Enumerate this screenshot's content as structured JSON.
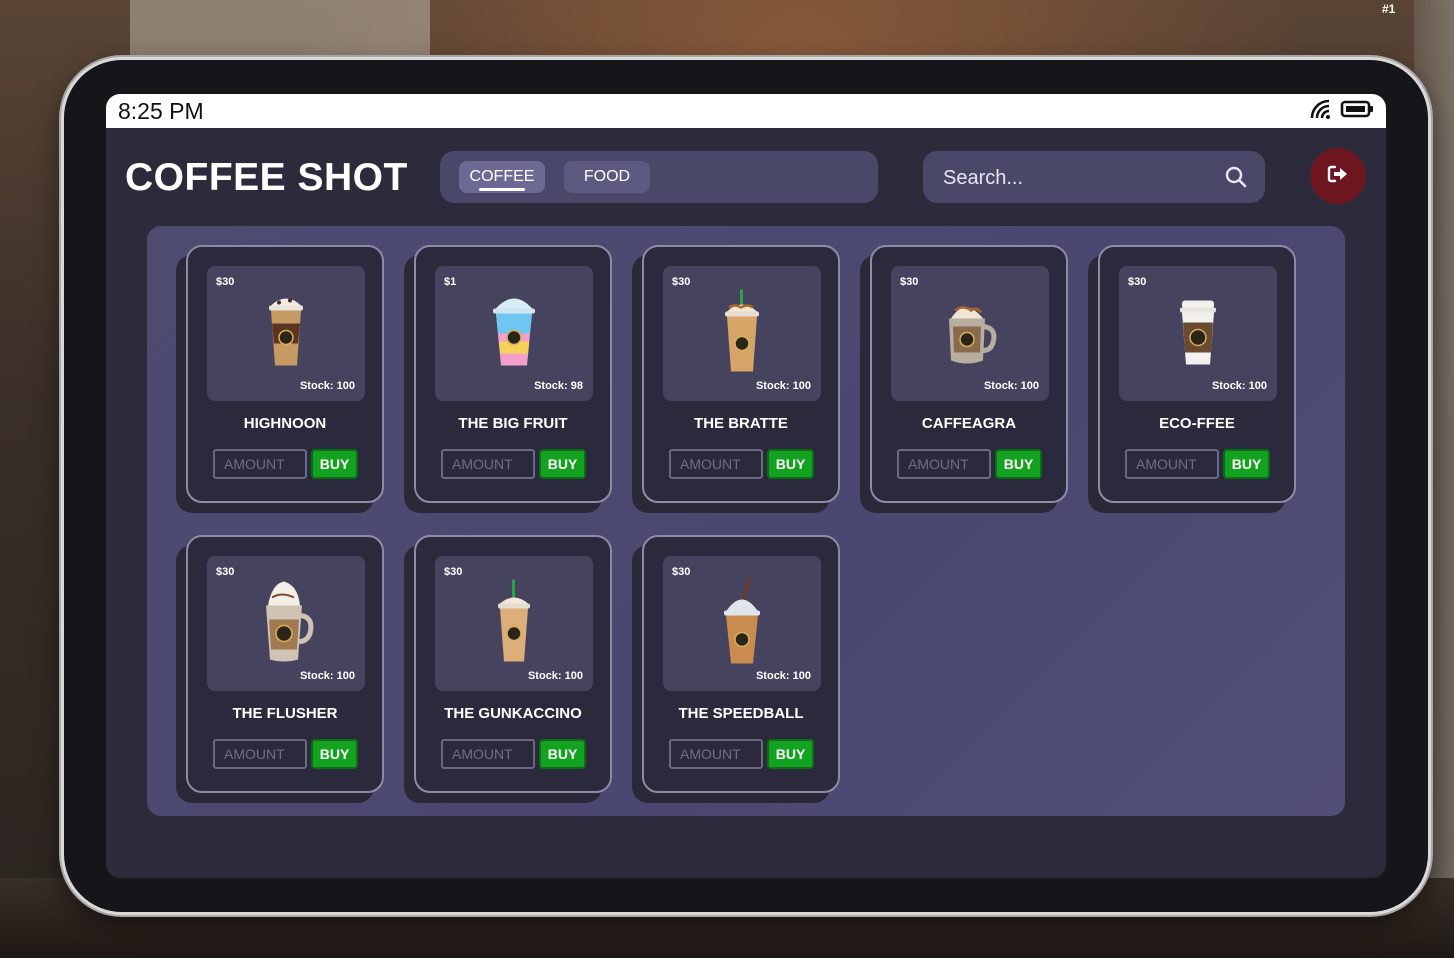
{
  "hud": {
    "rank": "#1"
  },
  "status_bar": {
    "time": "8:25 PM"
  },
  "app": {
    "title": "COFFEE SHOT",
    "tabs": [
      {
        "label": "COFFEE",
        "active": true
      },
      {
        "label": "FOOD",
        "active": false
      }
    ],
    "search": {
      "placeholder": "Search..."
    },
    "amount_placeholder": "AMOUNT",
    "buy_label": "BUY",
    "accent_color": "#14a321",
    "exit_color": "#6e1620"
  },
  "products": [
    {
      "name": "HIGHNOON",
      "price": "$30",
      "stock": "Stock: 100",
      "icon": "iced-coffee-chocolate-icon"
    },
    {
      "name": "THE BIG FRUIT",
      "price": "$1",
      "stock": "Stock: 98",
      "icon": "rainbow-frappe-icon"
    },
    {
      "name": "THE BRATTE",
      "price": "$30",
      "stock": "Stock: 100",
      "icon": "caramel-frappe-straw-icon"
    },
    {
      "name": "CAFFEAGRA",
      "price": "$30",
      "stock": "Stock: 100",
      "icon": "coffee-mug-cream-icon"
    },
    {
      "name": "ECO-FFEE",
      "price": "$30",
      "stock": "Stock: 100",
      "icon": "takeaway-coffee-cup-icon"
    },
    {
      "name": "THE FLUSHER",
      "price": "$30",
      "stock": "Stock: 100",
      "icon": "whipped-cream-mug-icon"
    },
    {
      "name": "THE GUNKACCINO",
      "price": "$30",
      "stock": "Stock: 100",
      "icon": "iced-latte-straw-icon"
    },
    {
      "name": "THE SPEEDBALL",
      "price": "$30",
      "stock": "Stock: 100",
      "icon": "frappe-dome-lid-icon"
    }
  ]
}
